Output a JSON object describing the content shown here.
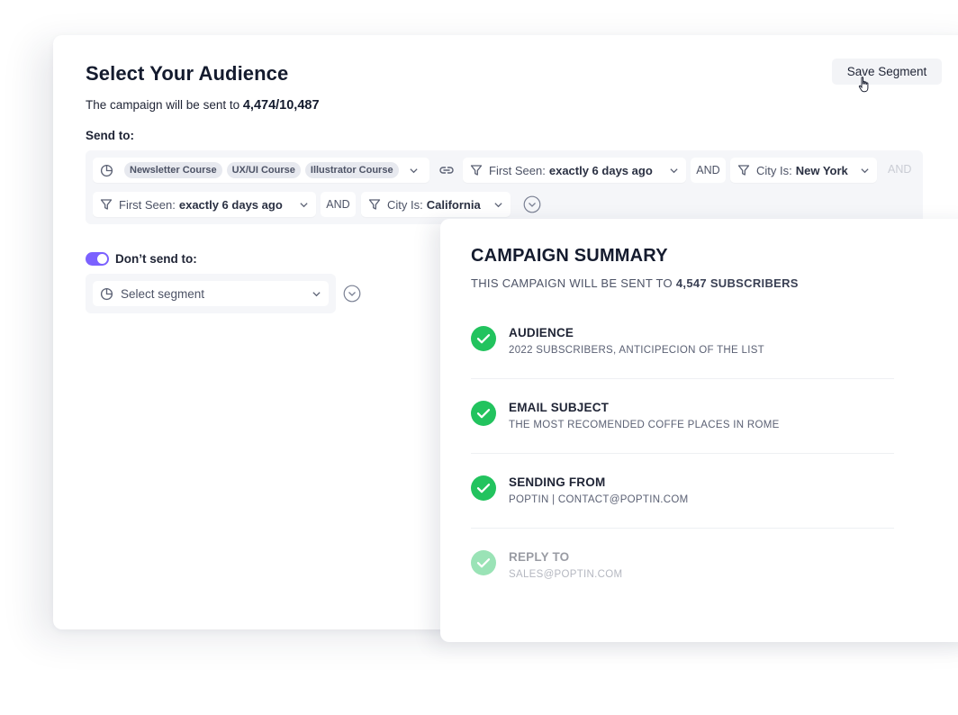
{
  "header": {
    "title": "Select Your Audience",
    "sent_prefix": "The campaign will be sent to",
    "sent_count": "4,474/10,487",
    "save_label": "Save Segment"
  },
  "send_to": {
    "label": "Send to:",
    "segments": [
      "Newsletter Course",
      "UX/UI Course",
      "Illustrator Course"
    ],
    "and_label": "AND",
    "filters": [
      {
        "key": "First Seen:",
        "value": "exactly 6 days ago"
      },
      {
        "key": "City Is:",
        "value": "New York"
      },
      {
        "key": "First Seen:",
        "value": "exactly 6 days ago"
      },
      {
        "key": "City Is:",
        "value": "California"
      }
    ]
  },
  "dont_send": {
    "label": "Don’t send to:",
    "enabled": true,
    "placeholder": "Select segment"
  },
  "summary": {
    "title": "CAMPAIGN SUMMARY",
    "sub_prefix": "THIS CAMPAIGN WILL BE SENT TO",
    "sub_count": "4,547 SUBSCRIBERS",
    "items": [
      {
        "title": "AUDIENCE",
        "detail": "2022 SUBSCRIBERS, ANTICIPECION OF THE LIST"
      },
      {
        "title": "EMAIL SUBJECT",
        "detail": "THE MOST RECOMENDED COFFE PLACES IN ROME"
      },
      {
        "title": "SENDING FROM",
        "detail": "POPTIN | CONTACT@POPTIN.COM"
      },
      {
        "title": "REPLY TO",
        "detail": "SALES@POPTIN.COM"
      }
    ]
  },
  "colors": {
    "accent": "#7b61ff",
    "success": "#22c35e",
    "panel_bg": "#f5f6f9"
  },
  "icons": [
    "pie-chart-icon",
    "chevron-down-icon",
    "link-icon",
    "filter-icon",
    "circle-chevron-down-icon",
    "check-circle-icon",
    "hand-cursor-icon"
  ]
}
